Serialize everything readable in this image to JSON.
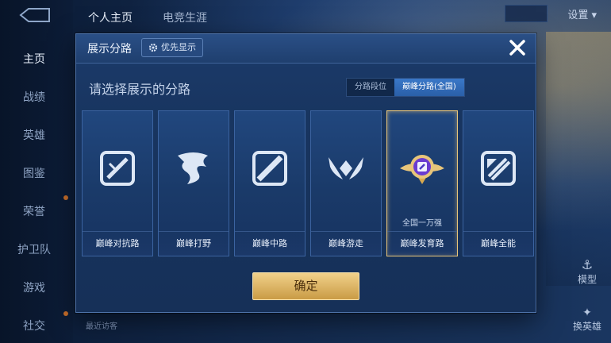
{
  "left_nav": {
    "items": [
      {
        "label": "主页",
        "active": true
      },
      {
        "label": "战绩"
      },
      {
        "label": "英雄"
      },
      {
        "label": "图鉴"
      },
      {
        "label": "荣誉"
      },
      {
        "label": "护卫队"
      },
      {
        "label": "游戏"
      },
      {
        "label": "社交"
      }
    ]
  },
  "top_tabs": [
    "个人主页",
    "电竞生涯"
  ],
  "settings_label": "设置",
  "right_buttons": {
    "model": "模型",
    "hero": "换英雄"
  },
  "recent_visitors": "最近访客",
  "dialog": {
    "title": "展示分路",
    "priority_button": "优先显示",
    "subtitle": "请选择展示的分路",
    "toggle": {
      "options": [
        "分路段位",
        "巅峰分路(全国)"
      ],
      "selected": 1
    },
    "cards": [
      {
        "label": "巅峰对抗路",
        "icon": "sword-icon"
      },
      {
        "label": "巅峰打野",
        "icon": "dragon-icon"
      },
      {
        "label": "巅峰中路",
        "icon": "slash-icon"
      },
      {
        "label": "巅峰游走",
        "icon": "wings-icon"
      },
      {
        "label": "巅峰发育路",
        "icon": "gold-badge-icon",
        "rank": "全国一万强",
        "selected": true
      },
      {
        "label": "巅峰全能",
        "icon": "allround-icon"
      }
    ],
    "confirm_label": "确定"
  },
  "colors": {
    "accent_gold": "#e8c57a",
    "dialog_bg": "#183560",
    "toggle_active": "#2a5fa8"
  }
}
